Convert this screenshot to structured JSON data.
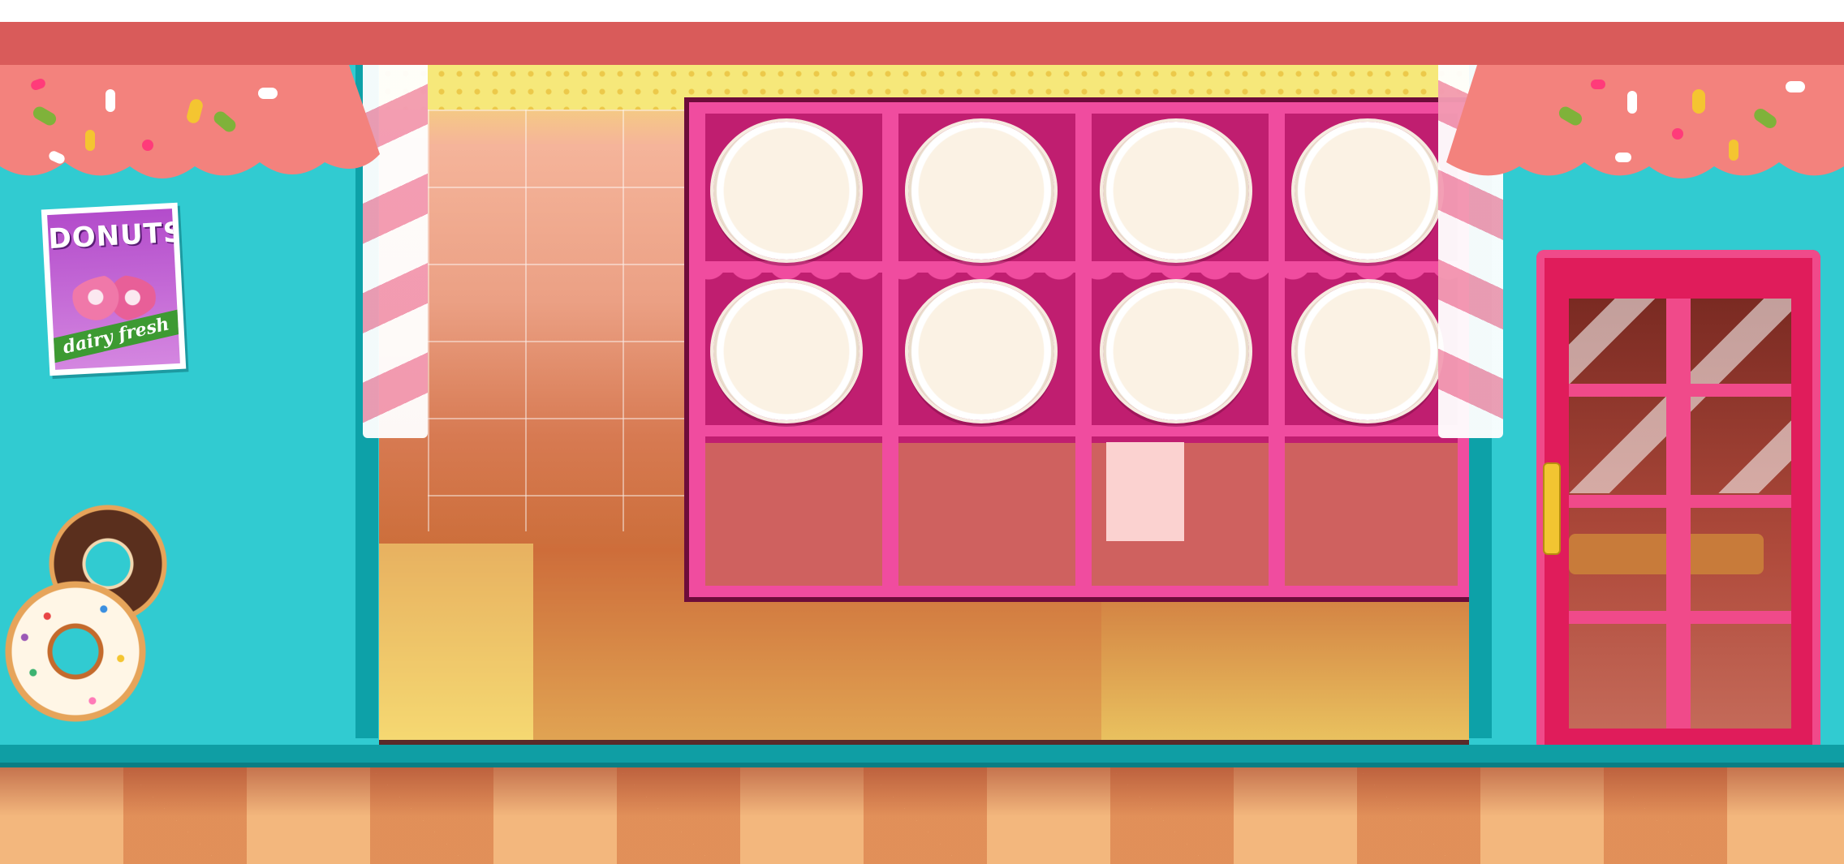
{
  "scene": "donut shop storefront",
  "colors": {
    "wall": "#31cbd1",
    "roof": "#d95b5a",
    "shelf": "#e23f8c",
    "door": "#e01c5b",
    "floor": "#f3b77d"
  },
  "poster": {
    "title": "DONUTS",
    "subtitle": "dairy fresh"
  },
  "shelf": {
    "rows": 2,
    "columns": 4,
    "slots_filled": 0
  }
}
